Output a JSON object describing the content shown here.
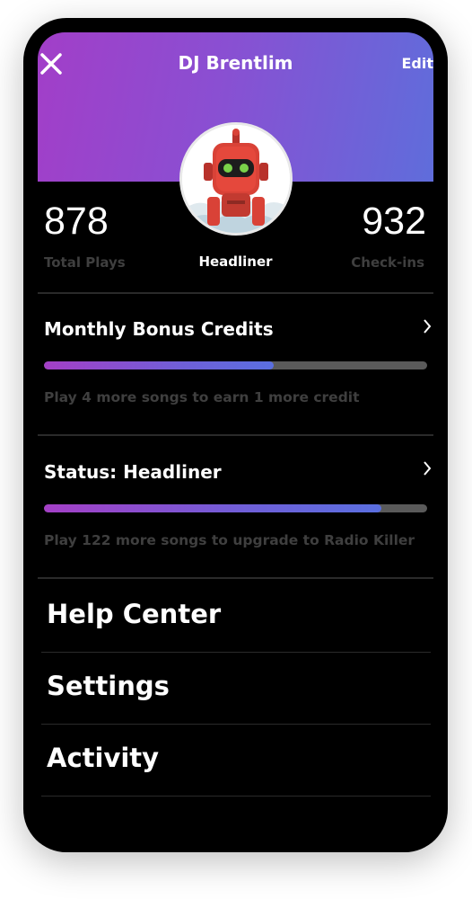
{
  "header": {
    "title": "DJ Brentlim",
    "edit_label": "Edit",
    "gradient_start": "#a23ec8",
    "gradient_end": "#5f6ddb"
  },
  "stats": {
    "plays_value": "878",
    "plays_label": "Total Plays",
    "checkins_value": "932",
    "checkins_label": "Check-ins",
    "rank_label": "Headliner"
  },
  "bonus": {
    "title": "Monthly Bonus Credits",
    "progress": 0.6,
    "helper": "Play 4 more songs to earn 1 more credit"
  },
  "status": {
    "title": "Status: Headliner",
    "progress": 0.88,
    "helper": "Play 122 more songs to upgrade to Radio Killer"
  },
  "menu": [
    {
      "label": "Help Center"
    },
    {
      "label": "Settings"
    },
    {
      "label": "Activity"
    }
  ],
  "icons": {
    "close": "close-icon",
    "chevron": "chevron-right-icon",
    "avatar": "robot-avatar"
  },
  "colors": {
    "background": "#000000",
    "muted_text": "#3f3f3f",
    "track": "#5a5a5a"
  }
}
